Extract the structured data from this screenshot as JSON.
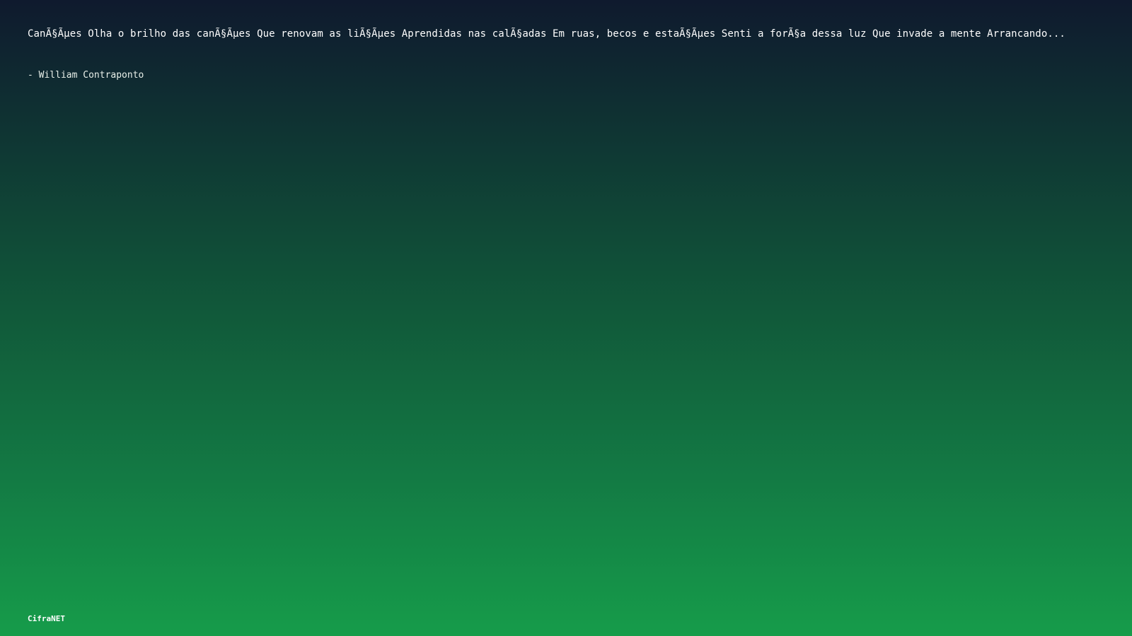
{
  "slide": {
    "lyrics_excerpt": "CanÃ§Ãµes Olha o brilho das canÃ§Ãµes Que renovam as liÃ§Ãµes Aprendidas nas calÃ§adas Em ruas, becos e estaÃ§Ãµes Senti a forÃ§a dessa luz Que invade a mente Arrancando...",
    "author": "- William Contraponto",
    "brand": "CifraNET"
  },
  "colors": {
    "gradient_top": "#0f1a2e",
    "gradient_bottom": "#169c4a",
    "text": "#ffffff"
  }
}
